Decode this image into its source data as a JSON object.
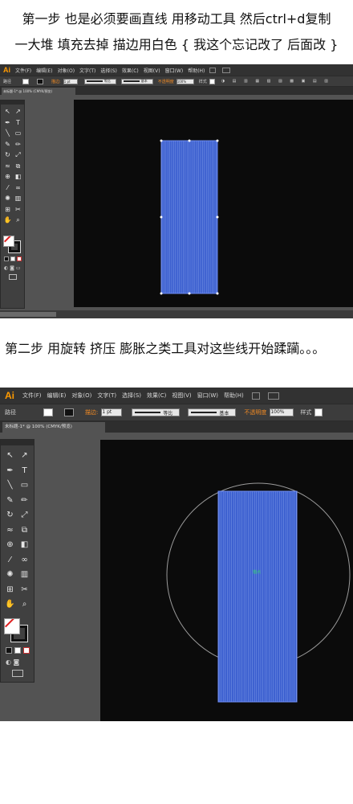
{
  "captions": {
    "line1": "第一步 也是必须要画直线 用移动工具 然后ctrl+d复制",
    "line2": "一大堆 填充去掉 描边用白色 { 我这个忘记改了 后面改 }",
    "line3": "第二步 用旋转 挤压 膨胀之类工具对这些线开始蹂躏。。。"
  },
  "app": {
    "logo": "Ai"
  },
  "menu": [
    "文件(F)",
    "编辑(E)",
    "对象(O)",
    "文字(T)",
    "选择(S)",
    "效果(C)",
    "视图(V)",
    "窗口(W)",
    "帮助(H)"
  ],
  "control_bar": {
    "path_label": "路径",
    "stroke_label": "描边:",
    "stroke_value": "1 pt",
    "uniform_label": "等比",
    "basic_label": "基本",
    "opacity_label": "不透明度",
    "opacity_value": "100%",
    "style_label": "样式"
  },
  "document_tab": "未标题-1* @ 100% (CMYK/预览)",
  "document_tab_short": "未标题-1* @ 100% (CMYK/预览)",
  "tooltip_label": "锚点",
  "colors": {
    "rect_fill": "#3b5fcf",
    "rect_line": "#8fa8f0",
    "canvas": "#0b0b0b",
    "workspace": "#535353",
    "accent": "#ff9a00"
  },
  "icons": [
    "selection-tool-icon",
    "direct-selection-icon",
    "pen-icon",
    "type-icon",
    "line-icon",
    "rectangle-icon",
    "brush-icon",
    "pencil-icon",
    "rotate-icon",
    "scale-icon",
    "warp-icon",
    "free-transform-icon",
    "shape-builder-icon",
    "gradient-icon",
    "eyedropper-icon",
    "blend-icon",
    "symbol-sprayer-icon",
    "graph-icon",
    "artboard-icon",
    "slice-icon",
    "hand-icon",
    "zoom-icon"
  ]
}
